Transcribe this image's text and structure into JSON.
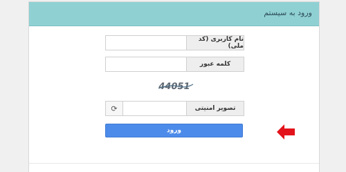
{
  "header": {
    "title": "ورود به سیستم"
  },
  "form": {
    "username_label": "نام کاربری (کد ملی)",
    "username_value": "",
    "password_label": "کلمه عبور",
    "password_value": "",
    "captcha_text": "44051",
    "security_label": "تصویر امنیتی",
    "security_value": "",
    "submit_label": "ورود"
  },
  "icons": {
    "password_toggle": "eye-icon",
    "refresh": "refresh-icon",
    "pointer": "red-arrow-icon"
  },
  "colors": {
    "header_bg": "#8fd0d3",
    "submit_bg": "#4d8bea",
    "arrow": "#e3131b"
  }
}
